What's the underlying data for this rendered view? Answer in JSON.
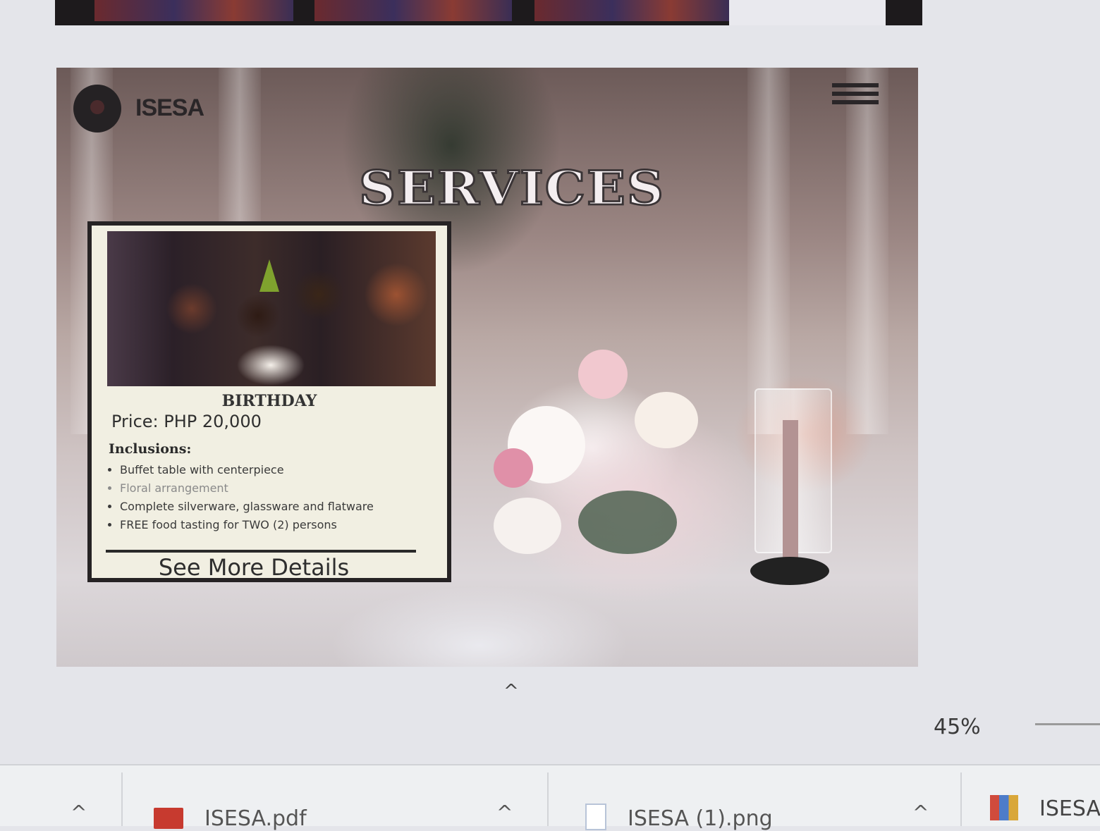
{
  "slide": {
    "brand_name": "ISESA",
    "title": "SERVICES",
    "card": {
      "heading": "BIRTHDAY",
      "price": "Price: PHP 20,000",
      "inclusions_label": "Inclusions:",
      "inclusions": [
        "Buffet table with centerpiece",
        "Floral arrangement",
        "Complete silverware, glassware and flatware",
        "FREE food tasting for TWO (2) persons"
      ],
      "link_label": "See More Details"
    }
  },
  "viewer": {
    "zoom": "45%"
  },
  "downloads": {
    "items": [
      "ISESA.pdf",
      "ISESA (1).png"
    ],
    "app_label": "ISESA"
  },
  "icons": {
    "chevron": "^"
  }
}
